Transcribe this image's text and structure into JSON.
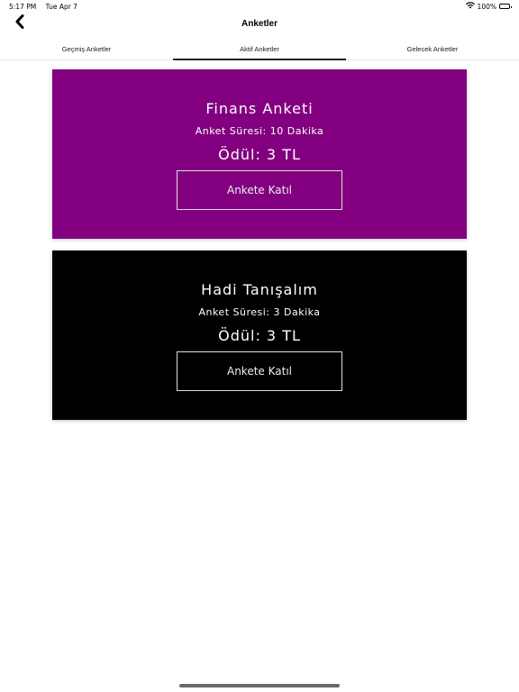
{
  "status_bar": {
    "time": "5:17 PM",
    "date": "Tue Apr 7",
    "battery": "100%"
  },
  "header": {
    "title": "Anketler",
    "back_icon": "chevron-left-icon"
  },
  "tabs": [
    {
      "label": "Geçmiş Anketler",
      "active": false
    },
    {
      "label": "Aktif Anketler",
      "active": true
    },
    {
      "label": "Gelecek Anketler",
      "active": false
    }
  ],
  "surveys": [
    {
      "title": "Finans Anketi",
      "duration": "Anket Süresi: 10 Dakika",
      "reward": "Ödül: 3 TL",
      "button_label": "Ankete Katıl",
      "color": "#820080"
    },
    {
      "title": "Hadi Tanışalım",
      "duration": "Anket Süresi: 3 Dakika",
      "reward": "Ödül: 3 TL",
      "button_label": "Ankete Katıl",
      "color": "#000000"
    }
  ]
}
